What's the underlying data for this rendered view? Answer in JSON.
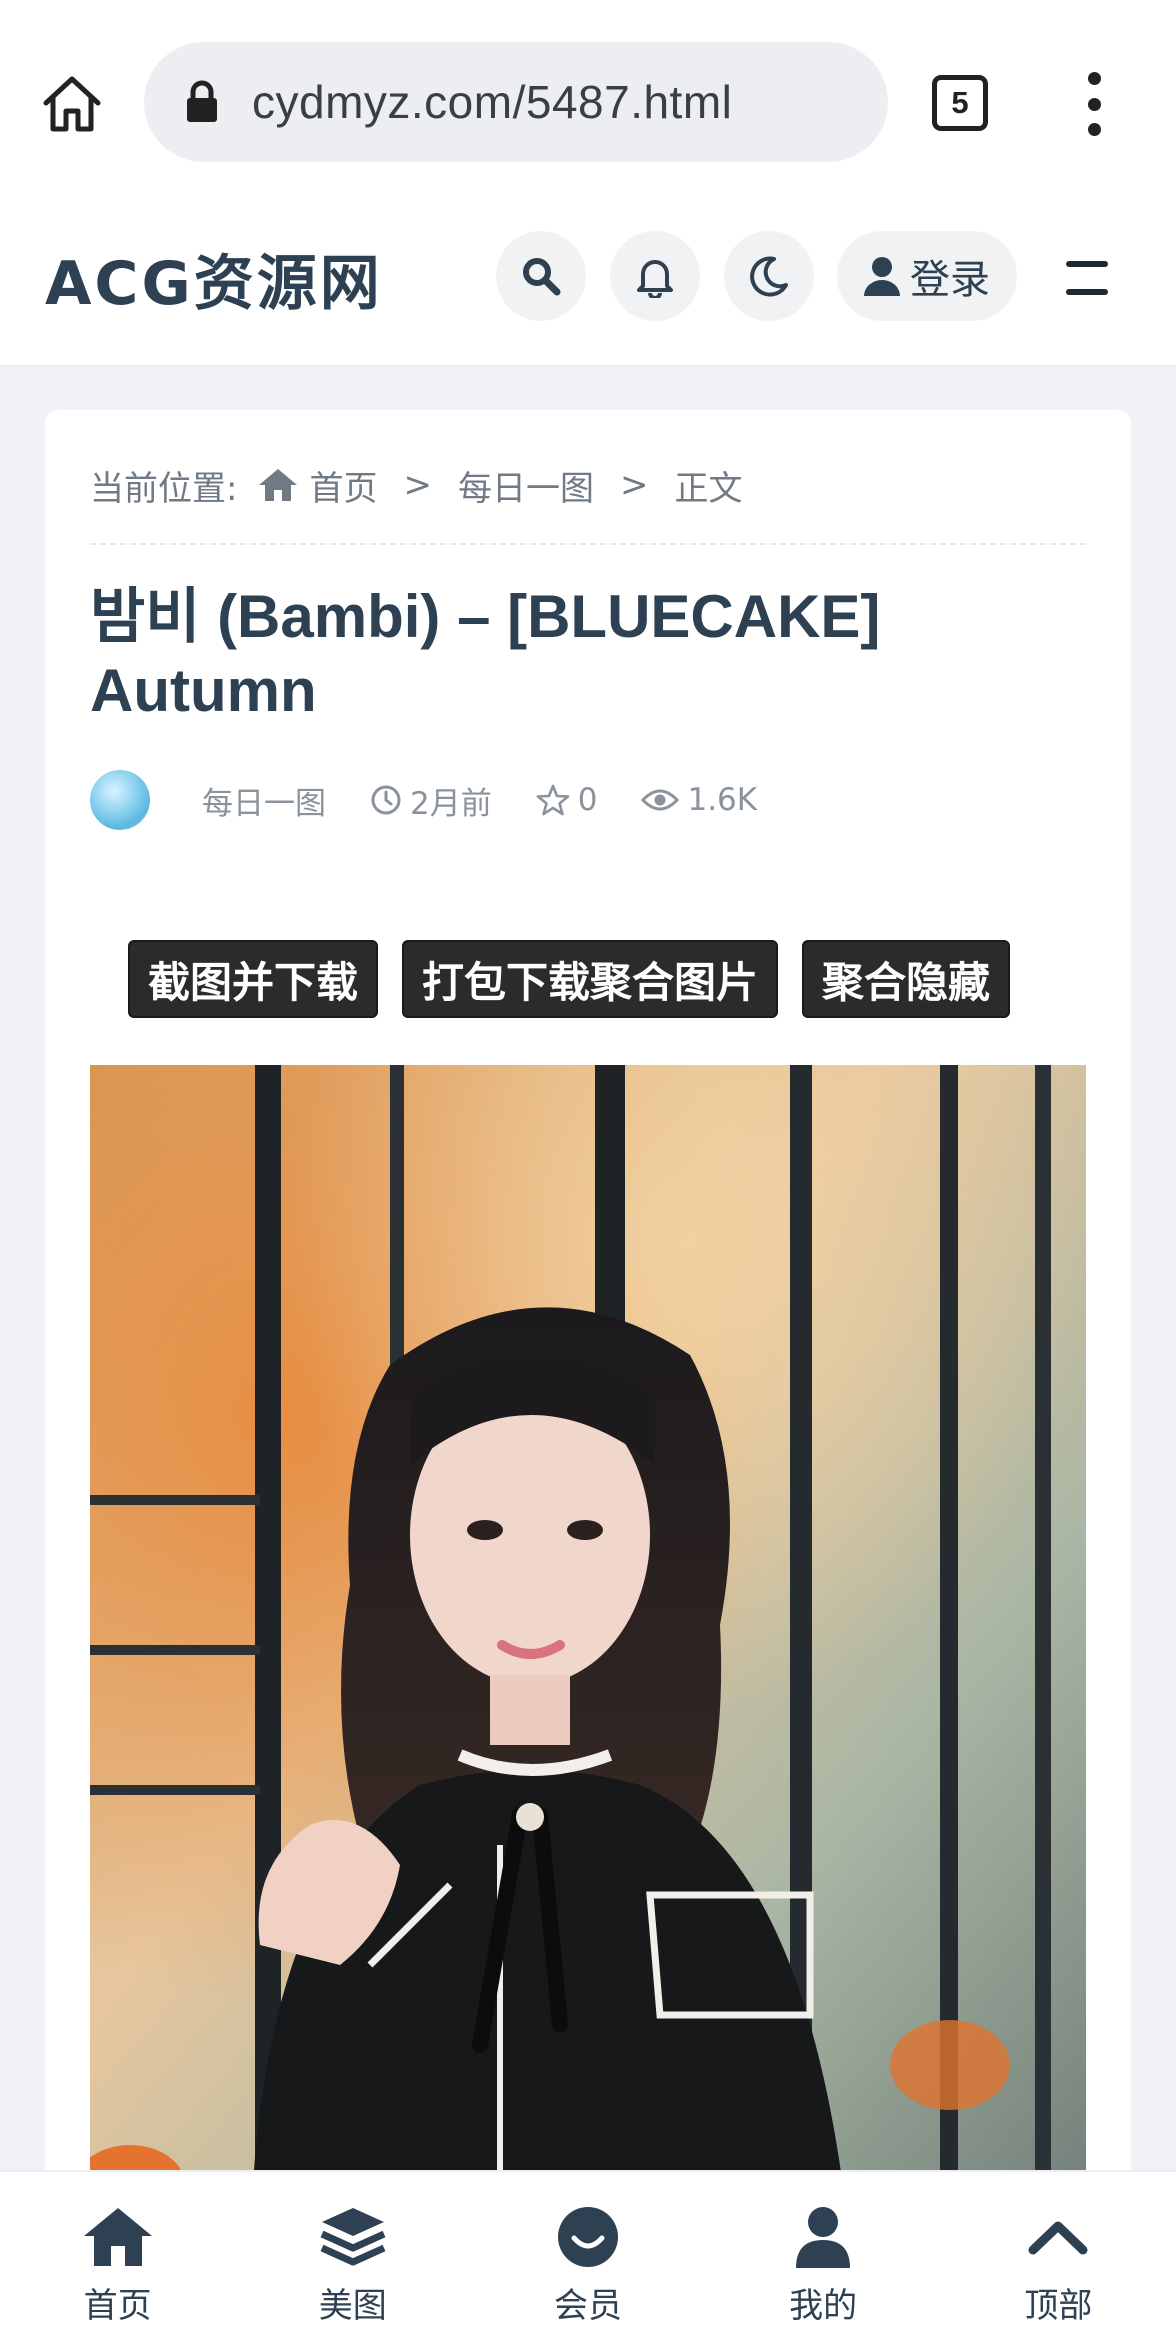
{
  "browser": {
    "url": "cydmyz.com/5487.html",
    "tab_count": "5"
  },
  "header": {
    "logo": "ACG资源网",
    "login_label": "登录"
  },
  "breadcrumb": {
    "prefix": "当前位置:",
    "items": [
      "首页",
      "每日一图",
      "正文"
    ],
    "separator": ">"
  },
  "post": {
    "title": "밤비 (Bambi) – [BLUECAKE] Autumn",
    "category": "每日一图",
    "time": "2月前",
    "favorites": "0",
    "views": "1.6K"
  },
  "actions": [
    "截图并下载",
    "打包下载聚合图片",
    "聚合隐藏"
  ],
  "tabbar": [
    {
      "label": "首页",
      "icon": "home-icon"
    },
    {
      "label": "美图",
      "icon": "layers-icon"
    },
    {
      "label": "会员",
      "icon": "smile-icon"
    },
    {
      "label": "我的",
      "icon": "user-icon"
    },
    {
      "label": "顶部",
      "icon": "chevron-up-icon"
    }
  ],
  "colors": {
    "text_dark": "#2d4153",
    "muted": "#8a939c",
    "button_bg": "#2b2b2b"
  }
}
